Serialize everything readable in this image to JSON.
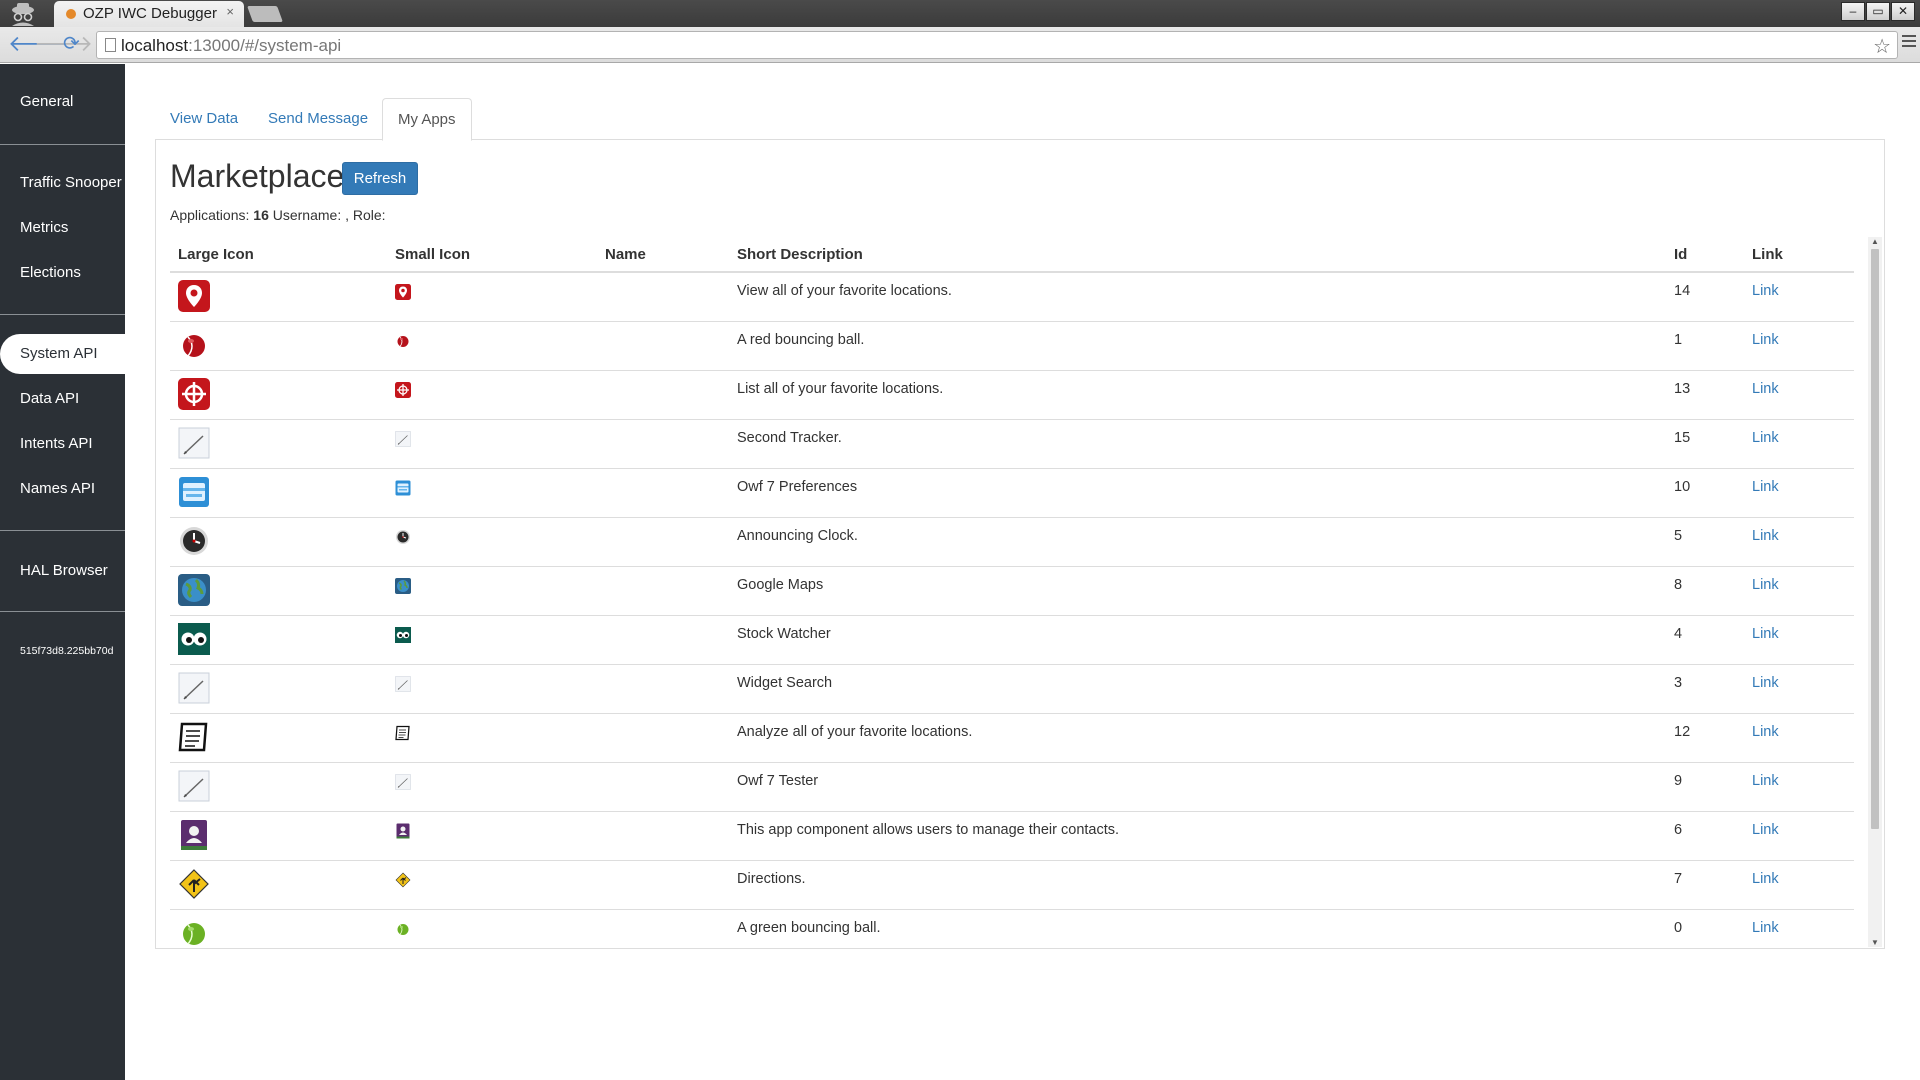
{
  "browser": {
    "tab_title": "OZP IWC Debugger",
    "tab_close": "×",
    "url_host": "localhost",
    "url_rest": ":13000/#/system-api",
    "star": "☆",
    "window_buttons": [
      "–",
      "▭",
      "✕"
    ]
  },
  "sidebar": {
    "items": [
      {
        "label": "General"
      },
      {
        "label": "Traffic Snooper"
      },
      {
        "label": "Metrics"
      },
      {
        "label": "Elections"
      },
      {
        "label": "System API"
      },
      {
        "label": "Data API"
      },
      {
        "label": "Intents API"
      },
      {
        "label": "Names API"
      },
      {
        "label": "HAL Browser"
      }
    ],
    "active": "System API",
    "version_hash": "515f73d8.225bb70d"
  },
  "tabs": [
    {
      "label": "View Data"
    },
    {
      "label": "Send Message"
    },
    {
      "label": "My Apps"
    }
  ],
  "active_tab": "My Apps",
  "marketplace": {
    "title": "Marketplace",
    "refresh_label": "Refresh",
    "applications_label": "Applications:",
    "applications_count": "16",
    "username_label": "Username:",
    "username_value": "",
    "role_label": ", Role:",
    "role_value": ""
  },
  "table": {
    "columns": [
      "Large Icon",
      "Small Icon",
      "Name",
      "Short Description",
      "Id",
      "Link"
    ],
    "rows": [
      {
        "icon": "map-pin-icon",
        "name": "",
        "description": "View all of your favorite locations.",
        "id": "14",
        "link": "Link"
      },
      {
        "icon": "red-ball-icon",
        "name": "",
        "description": "A red bouncing ball.",
        "id": "1",
        "link": "Link"
      },
      {
        "icon": "crosshair-icon",
        "name": "",
        "description": "List all of your favorite locations.",
        "id": "13",
        "link": "Link"
      },
      {
        "icon": "placeholder-icon",
        "name": "",
        "description": "Second Tracker.",
        "id": "15",
        "link": "Link"
      },
      {
        "icon": "preferences-icon",
        "name": "",
        "description": "Owf 7 Preferences",
        "id": "10",
        "link": "Link"
      },
      {
        "icon": "clock-icon",
        "name": "",
        "description": "Announcing Clock.",
        "id": "5",
        "link": "Link"
      },
      {
        "icon": "globe-icon",
        "name": "",
        "description": "Google Maps",
        "id": "8",
        "link": "Link"
      },
      {
        "icon": "eyes-icon",
        "name": "",
        "description": "Stock Watcher",
        "id": "4",
        "link": "Link"
      },
      {
        "icon": "placeholder-icon",
        "name": "",
        "description": "Widget Search",
        "id": "3",
        "link": "Link"
      },
      {
        "icon": "document-icon",
        "name": "",
        "description": "Analyze all of your favorite locations.",
        "id": "12",
        "link": "Link"
      },
      {
        "icon": "placeholder-icon",
        "name": "",
        "description": "Owf 7 Tester",
        "id": "9",
        "link": "Link"
      },
      {
        "icon": "contacts-icon",
        "name": "",
        "description": "This app component allows users to manage their contacts.",
        "id": "6",
        "link": "Link"
      },
      {
        "icon": "directions-icon",
        "name": "",
        "description": "Directions.",
        "id": "7",
        "link": "Link"
      },
      {
        "icon": "green-ball-icon",
        "name": "",
        "description": "A green bouncing ball.",
        "id": "0",
        "link": "Link"
      }
    ]
  },
  "colors": {
    "sidebar_bg": "#2b3036",
    "link": "#337ab7",
    "button": "#337ab7"
  }
}
